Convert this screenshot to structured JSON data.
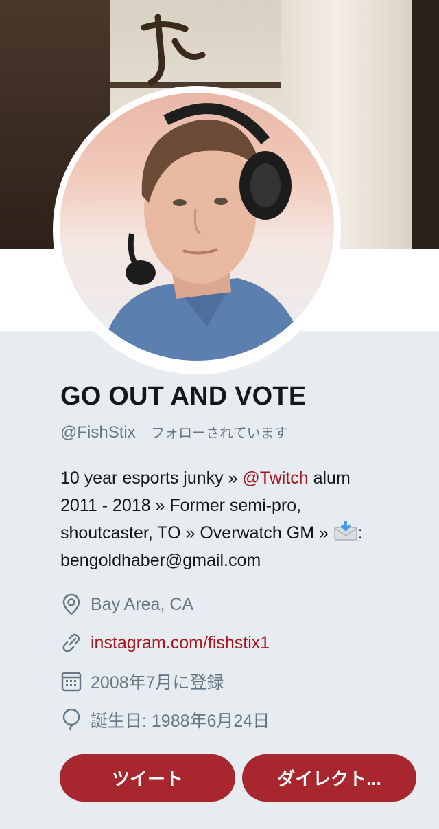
{
  "profile": {
    "display_name": "GO OUT AND VOTE",
    "handle": "@FishStix",
    "follows_you": "フォローされています",
    "bio": {
      "line1_pre": "10 year esports junky » ",
      "line1_mention": "@Twitch",
      "line1_post": " alum",
      "line2": "2011 - 2018 » Former semi-pro,",
      "line3_pre": "shoutcaster, TO » Overwatch GM » ",
      "line3_post": ":",
      "line4": "bengoldhaber@gmail.com"
    },
    "location": "Bay Area, CA",
    "website": "instagram.com/fishstix1",
    "joined": "2008年7月に登録",
    "birthday": "誕生日: 1988年6月24日"
  },
  "actions": {
    "tweet_label": "ツイート",
    "dm_label": "ダイレクト..."
  },
  "colors": {
    "accent": "#a8262d",
    "link": "#a8141f",
    "muted": "#657786",
    "background": "#e6ecf0"
  },
  "icons": {
    "location": "location-pin-icon",
    "link": "link-icon",
    "calendar": "calendar-icon",
    "birthday": "balloon-icon",
    "envelope": "envelope-download-icon"
  }
}
